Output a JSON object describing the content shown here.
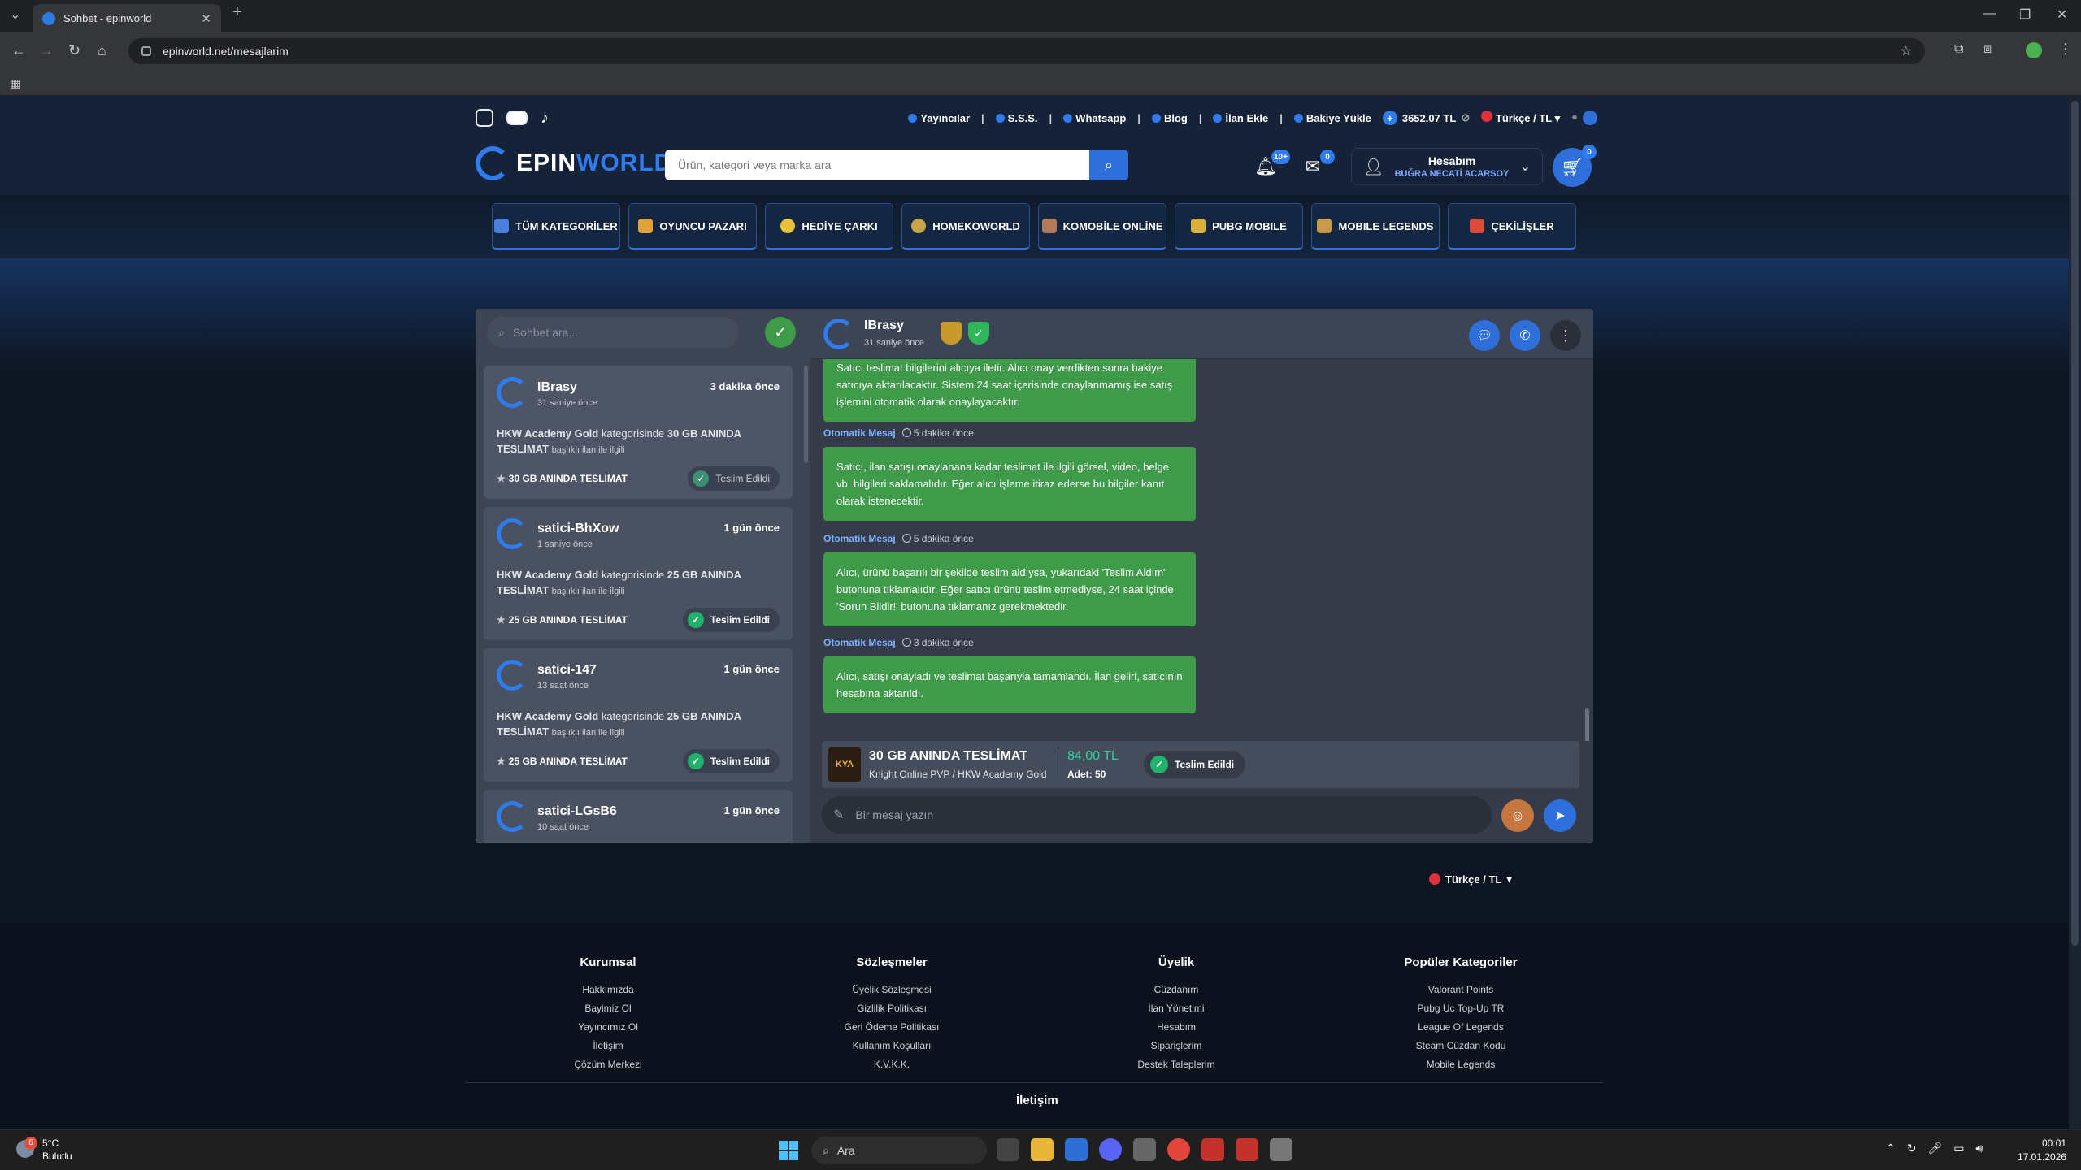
{
  "browser": {
    "tab_title": "Sohbet - epinworld",
    "url": "epinworld.net/mesajlarim"
  },
  "topbar": {
    "links": [
      "Yayıncılar",
      "S.S.S.",
      "Whatsapp",
      "Blog",
      "İlan Ekle",
      "Bakiye Yükle"
    ],
    "balance": "3652.07 TL",
    "language": "Türkçe / TL"
  },
  "header": {
    "logo_e": "EPIN",
    "logo_w": "WORLD",
    "search_placeholder": "Ürün, kategori veya marka ara",
    "notif_count": "10+",
    "mail_count": "0",
    "account_title": "Hesabım",
    "account_user": "BUĞRA NECATİ ACARSOY",
    "cart_count": "0"
  },
  "categories": [
    "TÜM KATEGORİLER",
    "OYUNCU PAZARI",
    "HEDİYE ÇARKI",
    "HOMEKOWORLD",
    "KOMOBİLE ONLİNE",
    "PUBG MOBILE",
    "MOBILE LEGENDS",
    "ÇEKİLİŞLER"
  ],
  "chat": {
    "search_placeholder": "Sohbet ara...",
    "conversations": [
      {
        "name": "IBrasy",
        "status": "31 saniye önce",
        "time": "3 dakika önce",
        "game": "HKW Academy Gold",
        "mid": "kategorisinde",
        "item": "30 GB ANINDA TESLİMAT",
        "tail": "başlıklı ilan ile ilgili",
        "product": "30 GB ANINDA TESLİMAT",
        "badge": "Teslim Edildi"
      },
      {
        "name": "satici-BhXow",
        "status": "1 saniye önce",
        "time": "1 gün önce",
        "game": "HKW Academy Gold",
        "mid": "kategorisinde",
        "item": "25 GB ANINDA TESLİMAT",
        "tail": "başlıklı ilan ile ilgili",
        "product": "25 GB ANINDA TESLİMAT",
        "badge": "Teslim Edildi"
      },
      {
        "name": "satici-147",
        "status": "13 saat önce",
        "time": "1 gün önce",
        "game": "HKW Academy Gold",
        "mid": "kategorisinde",
        "item": "25 GB ANINDA TESLİMAT",
        "tail": "başlıklı ilan ile ilgili",
        "product": "25 GB ANINDA TESLİMAT",
        "badge": "Teslim Edildi"
      },
      {
        "name": "satici-LGsB6",
        "status": "10 saat önce",
        "time": "1 gün önce"
      }
    ],
    "header": {
      "name": "IBrasy",
      "status": "31 saniye önce"
    },
    "messages": [
      {
        "text": "Satıcı teslimat bilgilerini alıcıya iletir. Alıcı onay verdikten sonra bakiye satıcıya aktarılacaktır. Sistem 24 saat içerisinde onaylanmamış ise satış işlemini otomatik olarak onaylayacaktır."
      },
      {
        "who": "Otomatik Mesaj",
        "when": "5 dakika önce",
        "text": "Satıcı, ilan satışı onaylanana kadar teslimat ile ilgili görsel, video, belge vb. bilgileri saklamalıdır. Eğer alıcı işleme itiraz ederse bu bilgiler kanıt olarak istenecektir."
      },
      {
        "who": "Otomatik Mesaj",
        "when": "5 dakika önce",
        "text": "Alıcı, ürünü başarılı bir şekilde teslim aldıysa, yukarıdaki 'Teslim Aldım' butonuna tıklamalıdır. Eğer satıcı ürünü teslim etmediyse, 24 saat içinde 'Sorun Bildir!' butonuna tıklamanız gerekmektedir."
      },
      {
        "who": "Otomatik Mesaj",
        "when": "3 dakika önce",
        "text": "Alıcı, satışı onayladı ve teslimat başarıyla tamamlandı. İlan geliri, satıcının hesabına aktarıldı."
      }
    ],
    "product": {
      "thumb": "KYA",
      "title": "30 GB ANINDA TESLİMAT",
      "subtitle": "Knight Online PVP / HKW Academy Gold",
      "price": "84,00 TL",
      "qty": "Adet: 50",
      "badge": "Teslim Edildi"
    },
    "composer_placeholder": "Bir mesaj yazın"
  },
  "language_bottom": "Türkçe / TL",
  "footer": {
    "columns": [
      {
        "title": "Kurumsal",
        "links": [
          "Hakkımızda",
          "Bayimiz Ol",
          "Yayıncımız Ol",
          "İletişim",
          "Çözüm Merkezi"
        ]
      },
      {
        "title": "Sözleşmeler",
        "links": [
          "Üyelik Sözleşmesi",
          "Gizlilik Politikası",
          "Geri Ödeme Politikası",
          "Kullanım Koşulları",
          "K.V.K.K."
        ]
      },
      {
        "title": "Üyelik",
        "links": [
          "Cüzdanım",
          "İlan Yönetimi",
          "Hesabım",
          "Siparişlerim",
          "Destek Taleplerim"
        ]
      },
      {
        "title": "Popüler Kategoriler",
        "links": [
          "Valorant Points",
          "Pubg Uc Top-Up TR",
          "League Of Legends",
          "Steam Cüzdan Kodu",
          "Mobile Legends"
        ]
      }
    ],
    "contact_title": "İletişim"
  },
  "taskbar": {
    "weather_badge": "6",
    "temp": "5°C",
    "condition": "Bulutlu",
    "search": "Ara",
    "time": "00:01",
    "date": "17.01.2026"
  },
  "colors": {
    "accent": "#2f7cf0",
    "message_bg": "#3f9a4a",
    "success": "#20b26b"
  }
}
